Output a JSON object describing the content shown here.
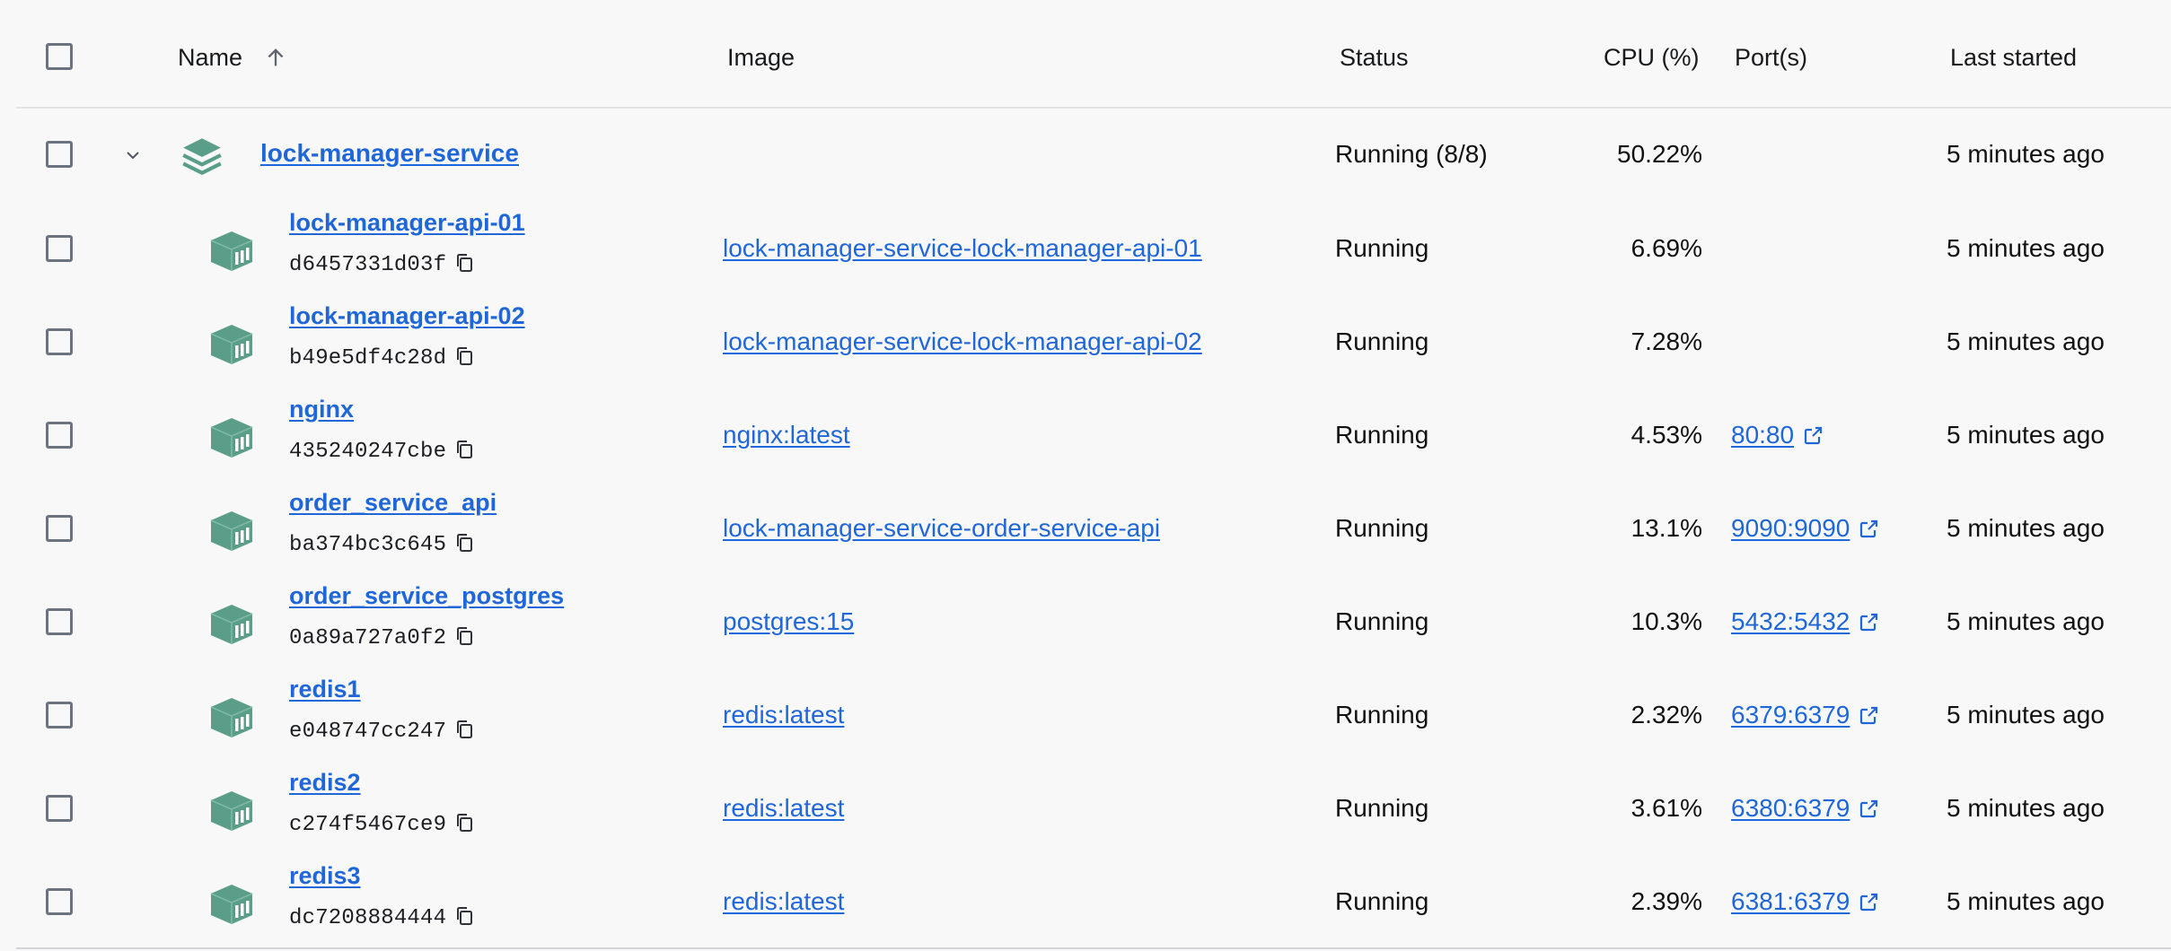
{
  "header": {
    "name": "Name",
    "image": "Image",
    "status": "Status",
    "cpu": "CPU (%)",
    "ports": "Port(s)",
    "last_started": "Last started"
  },
  "group": {
    "name": "lock-manager-service",
    "status": "Running (8/8)",
    "cpu": "50.22%",
    "last_started": "5 minutes ago"
  },
  "containers": [
    {
      "name": "lock-manager-api-01",
      "id": "d6457331d03f",
      "image": "lock-manager-service-lock-manager-api-01",
      "status": "Running",
      "cpu": "6.69%",
      "port": "",
      "last_started": "5 minutes ago"
    },
    {
      "name": "lock-manager-api-02",
      "id": "b49e5df4c28d",
      "image": "lock-manager-service-lock-manager-api-02",
      "status": "Running",
      "cpu": "7.28%",
      "port": "",
      "last_started": "5 minutes ago"
    },
    {
      "name": "nginx",
      "id": "435240247cbe",
      "image": "nginx:latest",
      "status": "Running",
      "cpu": "4.53%",
      "port": "80:80",
      "last_started": "5 minutes ago"
    },
    {
      "name": "order_service_api",
      "id": "ba374bc3c645",
      "image": "lock-manager-service-order-service-api",
      "status": "Running",
      "cpu": "13.1%",
      "port": "9090:9090",
      "last_started": "5 minutes ago"
    },
    {
      "name": "order_service_postgres",
      "id": "0a89a727a0f2",
      "image": "postgres:15",
      "status": "Running",
      "cpu": "10.3%",
      "port": "5432:5432",
      "last_started": "5 minutes ago"
    },
    {
      "name": "redis1",
      "id": "e048747cc247",
      "image": "redis:latest",
      "status": "Running",
      "cpu": "2.32%",
      "port": "6379:6379",
      "last_started": "5 minutes ago"
    },
    {
      "name": "redis2",
      "id": "c274f5467ce9",
      "image": "redis:latest",
      "status": "Running",
      "cpu": "3.61%",
      "port": "6380:6379",
      "last_started": "5 minutes ago"
    },
    {
      "name": "redis3",
      "id": "dc7208884444",
      "image": "redis:latest",
      "status": "Running",
      "cpu": "2.39%",
      "port": "6381:6379",
      "last_started": "5 minutes ago"
    }
  ],
  "colors": {
    "accent": "#1f67d8",
    "icon": "#5a9e8a"
  },
  "icons": {
    "sort": "arrow-up-icon",
    "expand": "chevron-down-icon",
    "stack": "layers-icon",
    "container": "container-cube-icon",
    "copy": "copy-icon",
    "external": "external-link-icon"
  }
}
